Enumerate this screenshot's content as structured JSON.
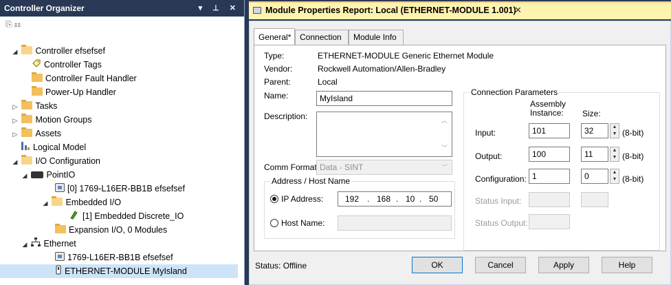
{
  "organizer": {
    "title": "Controller Organizer",
    "window_controls": "▾ ⊥ ✕",
    "toolbar_glyphs": "⎘ ☷",
    "items": [
      {
        "label": "Controller efsefsef",
        "expander": "◢",
        "icon": "folder-open"
      },
      {
        "label": "Controller Tags",
        "icon": "tag"
      },
      {
        "label": "Controller Fault Handler",
        "icon": "folder"
      },
      {
        "label": "Power-Up Handler",
        "icon": "folder"
      },
      {
        "label": "Tasks",
        "expander": "▷",
        "icon": "folder"
      },
      {
        "label": "Motion Groups",
        "expander": "▷",
        "icon": "folder"
      },
      {
        "label": "Assets",
        "expander": "▷",
        "icon": "folder"
      },
      {
        "label": "Logical Model",
        "icon": "logical-model"
      },
      {
        "label": "I/O Configuration",
        "expander": "◢",
        "icon": "folder-open"
      },
      {
        "label": "PointIO",
        "expander": "◢",
        "icon": "rack"
      },
      {
        "label": "[0] 1769-L16ER-BB1B efsefsef",
        "icon": "module"
      },
      {
        "label": "Embedded I/O",
        "expander": "◢",
        "icon": "folder-open"
      },
      {
        "label": "[1] Embedded Discrete_IO",
        "icon": "discrete-io"
      },
      {
        "label": "Expansion I/O, 0 Modules",
        "icon": "folder"
      },
      {
        "label": "Ethernet",
        "expander": "◢",
        "icon": "ethernet"
      },
      {
        "label": "1769-L16ER-BB1B efsefsef",
        "icon": "module"
      },
      {
        "label": "ETHERNET-MODULE MyIsland",
        "icon": "ethernet-module",
        "selected": true
      }
    ]
  },
  "dialog": {
    "tab_title": "Module Properties Report: Local (ETHERNET-MODULE 1.001)",
    "tab_close": "✕",
    "tabs": [
      "General*",
      "Connection",
      "Module Info"
    ],
    "type_label": "Type:",
    "type_value": "ETHERNET-MODULE Generic Ethernet Module",
    "vendor_label": "Vendor:",
    "vendor_value": "Rockwell Automation/Allen-Bradley",
    "parent_label": "Parent:",
    "parent_value": "Local",
    "name_label": "Name:",
    "name_value": "MyIsland",
    "description_label": "Description:",
    "description_value": "",
    "comm_format_label": "Comm Format:",
    "comm_format_value": "Data - SINT",
    "address_group_label": "Address / Host Name",
    "ip_label": "IP Address:",
    "ip": [
      "192",
      "168",
      "10",
      "50"
    ],
    "host_label": "Host Name:",
    "host_value": "",
    "conn": {
      "group_label": "Connection Parameters",
      "assembly_header": "Assembly\nInstance:",
      "size_header": "Size:",
      "input_label": "Input:",
      "input_instance": "101",
      "input_size": "32",
      "output_label": "Output:",
      "output_instance": "100",
      "output_size": "11",
      "config_label": "Configuration:",
      "config_instance": "1",
      "config_size": "0",
      "unit": "(8-bit)",
      "status_input_label": "Status Input:",
      "status_output_label": "Status Output:"
    },
    "status_text": "Status:  Offline",
    "ok_label": "OK",
    "cancel_label": "Cancel",
    "apply_label": "Apply",
    "help_label": "Help"
  }
}
